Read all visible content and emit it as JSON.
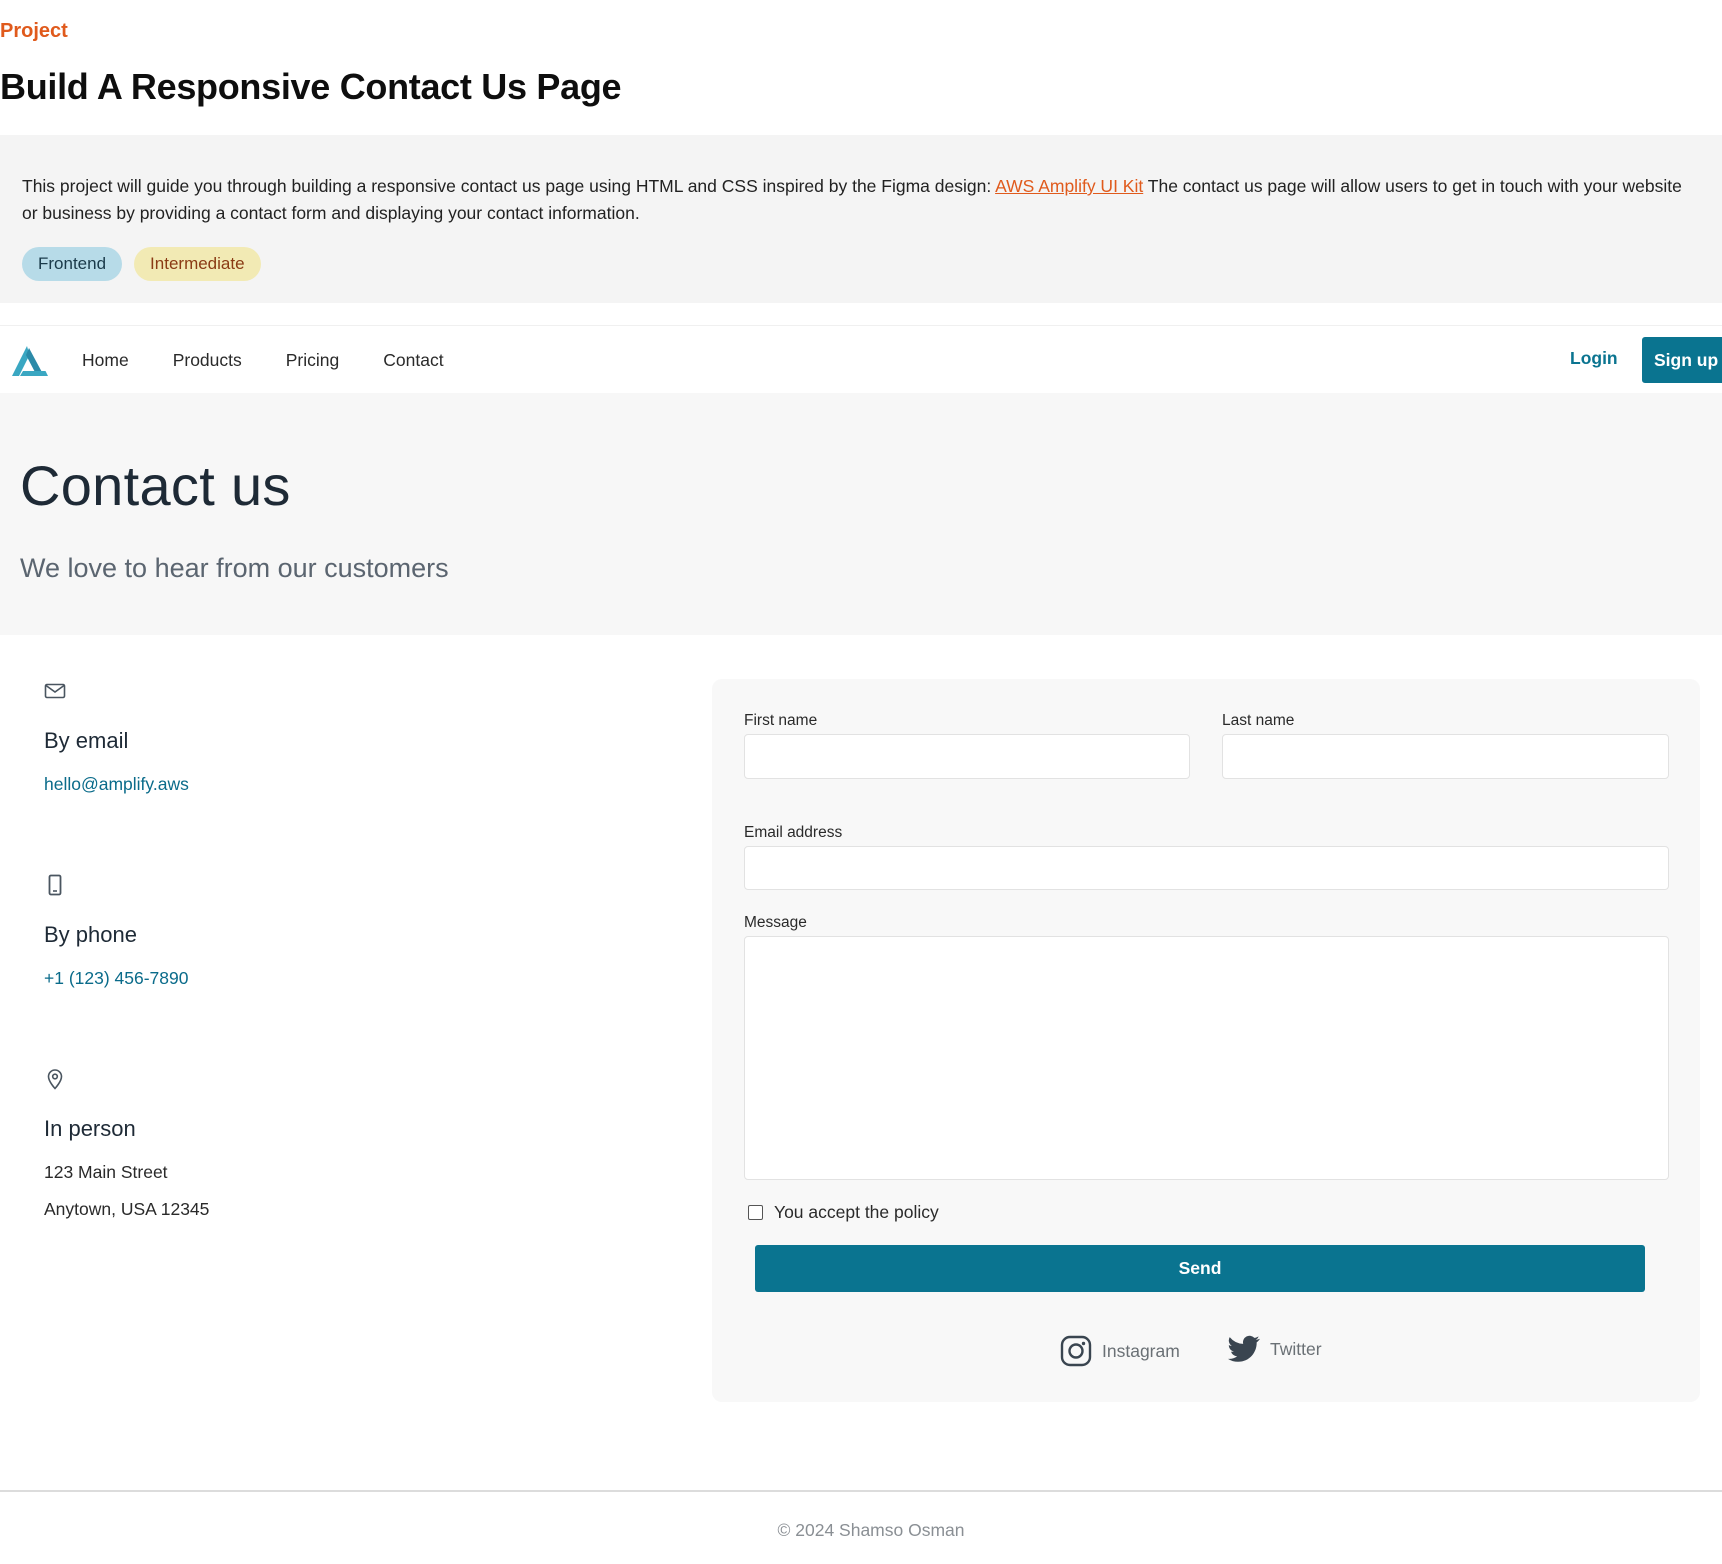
{
  "project": {
    "kicker": "Project",
    "title": "Build A Responsive Contact Us Page",
    "description_before": "This project will guide you through building a responsive contact us page using HTML and CSS inspired by the Figma design: ",
    "description_link": "AWS Amplify UI Kit",
    "description_after": " The contact us page will allow users to get in touch with your website or business by providing a contact form and displaying your contact information.",
    "tags": [
      "Frontend",
      "Intermediate"
    ]
  },
  "nav": {
    "logo_icon": "amplify-logo-icon",
    "links": [
      "Home",
      "Products",
      "Pricing",
      "Contact"
    ],
    "login_label": "Login",
    "signup_label": "Sign up"
  },
  "hero": {
    "title": "Contact us",
    "subtitle": "We love to hear from our customers"
  },
  "contact_info": {
    "email": {
      "icon": "mail-icon",
      "heading": "By email",
      "value": "hello@amplify.aws"
    },
    "phone": {
      "icon": "phone-icon",
      "heading": "By phone",
      "value": "+1 (123) 456-7890"
    },
    "person": {
      "icon": "map-pin-icon",
      "heading": "In person",
      "line1": "123 Main Street",
      "line2": "Anytown, USA 12345"
    }
  },
  "form": {
    "first_name_label": "First name",
    "first_name_value": "",
    "last_name_label": "Last name",
    "last_name_value": "",
    "email_label": "Email address",
    "email_value": "",
    "message_label": "Message",
    "message_value": "",
    "policy_label": "You accept the policy",
    "policy_checked": false,
    "send_label": "Send"
  },
  "social": [
    {
      "icon": "instagram-icon",
      "label": "Instagram"
    },
    {
      "icon": "twitter-icon",
      "label": "Twitter"
    }
  ],
  "footer": {
    "copyright": "© 2024 Shamso Osman"
  },
  "colors": {
    "accent": "#0a7490",
    "orange": "#e05a1c",
    "tag_frontend_bg": "#b7dbe8",
    "tag_intermediate_bg": "#f2eab4"
  }
}
